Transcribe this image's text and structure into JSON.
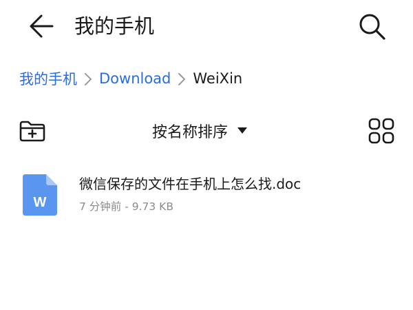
{
  "header": {
    "title": "我的手机",
    "back_icon": "arrow-left-icon",
    "search_icon": "search-icon"
  },
  "breadcrumb": {
    "items": [
      {
        "label": "我的手机"
      },
      {
        "label": "Download"
      },
      {
        "label": "WeiXin"
      }
    ],
    "separator_icon": "chevron-right-icon"
  },
  "toolbar": {
    "new_folder_icon": "folder-add-icon",
    "sort_label": "按名称排序",
    "sort_icon": "caret-down-icon",
    "view_icon": "grid-view-icon"
  },
  "files": [
    {
      "name": "微信保存的文件在手机上怎么找.doc",
      "meta": "7 分钟前 - 9.73 KB",
      "icon": "word-doc-icon",
      "icon_letter": "W"
    }
  ],
  "colors": {
    "link": "#2b6ce0",
    "text": "#1a1a1a",
    "secondary_text": "#8a8a8a",
    "doc_icon": "#5a96f0"
  }
}
